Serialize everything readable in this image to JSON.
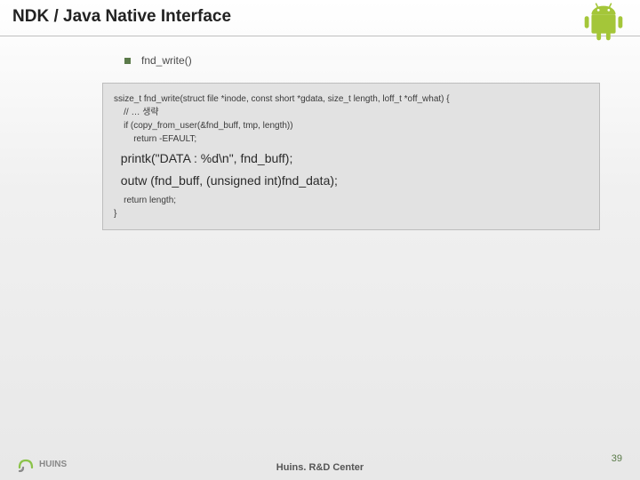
{
  "header": {
    "title": "NDK / Java Native Interface"
  },
  "bullet": {
    "label": "fnd_write()"
  },
  "code": {
    "sig": "ssize_t fnd_write(struct file *inode, const short *gdata, size_t length, loff_t *off_what) {",
    "comment": "    // … 생략",
    "ifline": "    if (copy_from_user(&fnd_buff, tmp, length))",
    "ret1": "        return -EFAULT;",
    "printk": "  printk(\"DATA : %d\\n\", fnd_buff);",
    "outw": "  outw (fnd_buff, (unsigned int)fnd_data);",
    "ret2": "    return length;",
    "close": "}"
  },
  "footer": {
    "huins": "HUINS",
    "center": "Huins. R&D Center",
    "page": "39"
  },
  "icons": {
    "android_color": "#a4c639"
  }
}
